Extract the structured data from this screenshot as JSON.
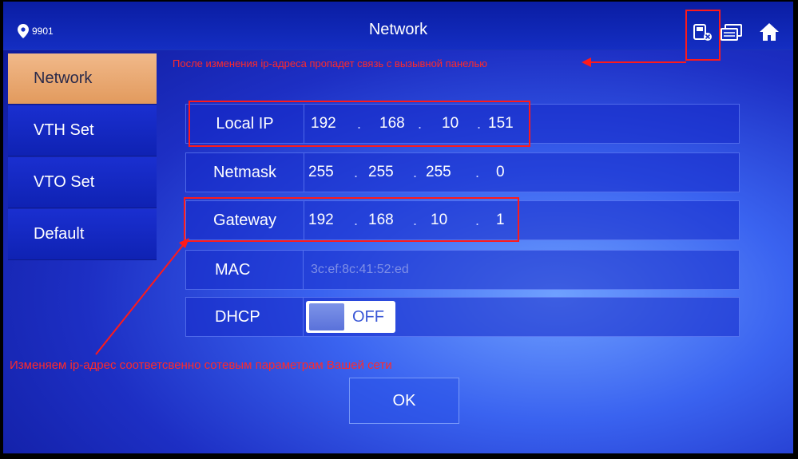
{
  "header": {
    "location_code": "9901",
    "title": "Network",
    "icons": [
      "location-pin-icon",
      "network-settings-icon",
      "monitor-icon",
      "home-icon"
    ]
  },
  "sidebar": {
    "items": [
      {
        "label": "Network",
        "active": true
      },
      {
        "label": "VTH Set",
        "active": false
      },
      {
        "label": "VTO Set",
        "active": false
      },
      {
        "label": "Default",
        "active": false
      }
    ]
  },
  "form": {
    "local_ip": {
      "label": "Local IP",
      "octets": [
        "192",
        "168",
        "10",
        "151"
      ]
    },
    "netmask": {
      "label": "Netmask",
      "octets": [
        "255",
        "255",
        "255",
        "0"
      ]
    },
    "gateway": {
      "label": "Gateway",
      "octets": [
        "192",
        "168",
        "10",
        "1"
      ]
    },
    "mac": {
      "label": "MAC",
      "value": "3c:ef:8c:41:52:ed"
    },
    "dhcp": {
      "label": "DHCP",
      "state": "OFF"
    },
    "separator": "."
  },
  "ok_label": "OK",
  "annotations": {
    "top_note": "После изменения ip-адреса пропадет связь с вызывной панелью",
    "bottom_note": "Изменяем ip-адрес соответсвенно сотевым параметрам Вашей сети"
  },
  "colors": {
    "annotation": "#ff2a2a",
    "active_tab": "#e9a873",
    "background": "#1d2fc4"
  }
}
